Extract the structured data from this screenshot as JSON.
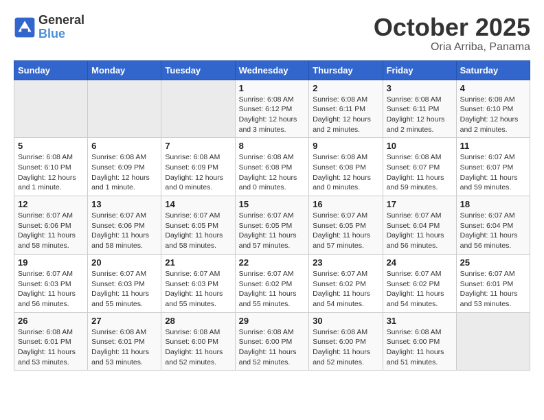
{
  "logo": {
    "line1": "General",
    "line2": "Blue"
  },
  "title": "October 2025",
  "subtitle": "Oria Arriba, Panama",
  "weekdays": [
    "Sunday",
    "Monday",
    "Tuesday",
    "Wednesday",
    "Thursday",
    "Friday",
    "Saturday"
  ],
  "weeks": [
    [
      {
        "day": "",
        "info": ""
      },
      {
        "day": "",
        "info": ""
      },
      {
        "day": "",
        "info": ""
      },
      {
        "day": "1",
        "info": "Sunrise: 6:08 AM\nSunset: 6:12 PM\nDaylight: 12 hours and 3 minutes."
      },
      {
        "day": "2",
        "info": "Sunrise: 6:08 AM\nSunset: 6:11 PM\nDaylight: 12 hours and 2 minutes."
      },
      {
        "day": "3",
        "info": "Sunrise: 6:08 AM\nSunset: 6:11 PM\nDaylight: 12 hours and 2 minutes."
      },
      {
        "day": "4",
        "info": "Sunrise: 6:08 AM\nSunset: 6:10 PM\nDaylight: 12 hours and 2 minutes."
      }
    ],
    [
      {
        "day": "5",
        "info": "Sunrise: 6:08 AM\nSunset: 6:10 PM\nDaylight: 12 hours and 1 minute."
      },
      {
        "day": "6",
        "info": "Sunrise: 6:08 AM\nSunset: 6:09 PM\nDaylight: 12 hours and 1 minute."
      },
      {
        "day": "7",
        "info": "Sunrise: 6:08 AM\nSunset: 6:09 PM\nDaylight: 12 hours and 0 minutes."
      },
      {
        "day": "8",
        "info": "Sunrise: 6:08 AM\nSunset: 6:08 PM\nDaylight: 12 hours and 0 minutes."
      },
      {
        "day": "9",
        "info": "Sunrise: 6:08 AM\nSunset: 6:08 PM\nDaylight: 12 hours and 0 minutes."
      },
      {
        "day": "10",
        "info": "Sunrise: 6:08 AM\nSunset: 6:07 PM\nDaylight: 11 hours and 59 minutes."
      },
      {
        "day": "11",
        "info": "Sunrise: 6:07 AM\nSunset: 6:07 PM\nDaylight: 11 hours and 59 minutes."
      }
    ],
    [
      {
        "day": "12",
        "info": "Sunrise: 6:07 AM\nSunset: 6:06 PM\nDaylight: 11 hours and 58 minutes."
      },
      {
        "day": "13",
        "info": "Sunrise: 6:07 AM\nSunset: 6:06 PM\nDaylight: 11 hours and 58 minutes."
      },
      {
        "day": "14",
        "info": "Sunrise: 6:07 AM\nSunset: 6:05 PM\nDaylight: 11 hours and 58 minutes."
      },
      {
        "day": "15",
        "info": "Sunrise: 6:07 AM\nSunset: 6:05 PM\nDaylight: 11 hours and 57 minutes."
      },
      {
        "day": "16",
        "info": "Sunrise: 6:07 AM\nSunset: 6:05 PM\nDaylight: 11 hours and 57 minutes."
      },
      {
        "day": "17",
        "info": "Sunrise: 6:07 AM\nSunset: 6:04 PM\nDaylight: 11 hours and 56 minutes."
      },
      {
        "day": "18",
        "info": "Sunrise: 6:07 AM\nSunset: 6:04 PM\nDaylight: 11 hours and 56 minutes."
      }
    ],
    [
      {
        "day": "19",
        "info": "Sunrise: 6:07 AM\nSunset: 6:03 PM\nDaylight: 11 hours and 56 minutes."
      },
      {
        "day": "20",
        "info": "Sunrise: 6:07 AM\nSunset: 6:03 PM\nDaylight: 11 hours and 55 minutes."
      },
      {
        "day": "21",
        "info": "Sunrise: 6:07 AM\nSunset: 6:03 PM\nDaylight: 11 hours and 55 minutes."
      },
      {
        "day": "22",
        "info": "Sunrise: 6:07 AM\nSunset: 6:02 PM\nDaylight: 11 hours and 55 minutes."
      },
      {
        "day": "23",
        "info": "Sunrise: 6:07 AM\nSunset: 6:02 PM\nDaylight: 11 hours and 54 minutes."
      },
      {
        "day": "24",
        "info": "Sunrise: 6:07 AM\nSunset: 6:02 PM\nDaylight: 11 hours and 54 minutes."
      },
      {
        "day": "25",
        "info": "Sunrise: 6:07 AM\nSunset: 6:01 PM\nDaylight: 11 hours and 53 minutes."
      }
    ],
    [
      {
        "day": "26",
        "info": "Sunrise: 6:08 AM\nSunset: 6:01 PM\nDaylight: 11 hours and 53 minutes."
      },
      {
        "day": "27",
        "info": "Sunrise: 6:08 AM\nSunset: 6:01 PM\nDaylight: 11 hours and 53 minutes."
      },
      {
        "day": "28",
        "info": "Sunrise: 6:08 AM\nSunset: 6:00 PM\nDaylight: 11 hours and 52 minutes."
      },
      {
        "day": "29",
        "info": "Sunrise: 6:08 AM\nSunset: 6:00 PM\nDaylight: 11 hours and 52 minutes."
      },
      {
        "day": "30",
        "info": "Sunrise: 6:08 AM\nSunset: 6:00 PM\nDaylight: 11 hours and 52 minutes."
      },
      {
        "day": "31",
        "info": "Sunrise: 6:08 AM\nSunset: 6:00 PM\nDaylight: 11 hours and 51 minutes."
      },
      {
        "day": "",
        "info": ""
      }
    ]
  ]
}
